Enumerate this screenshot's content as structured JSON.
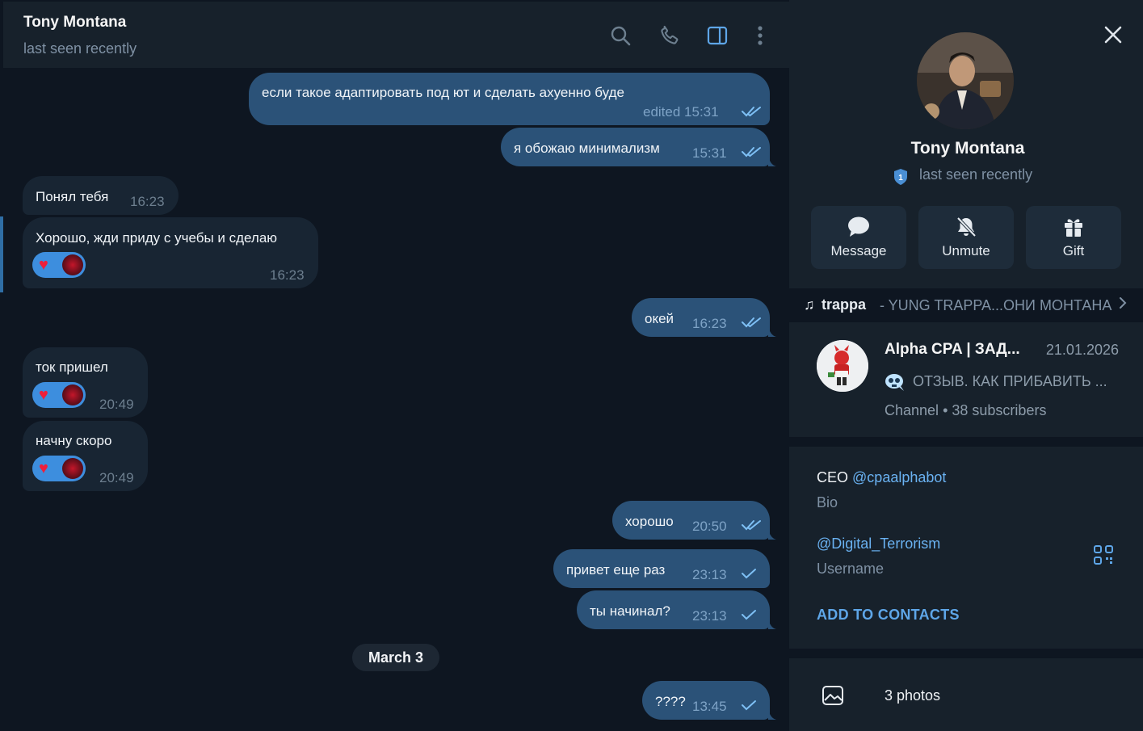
{
  "chat": {
    "title": "Tony Montana",
    "status": "last seen recently",
    "messages": [
      {
        "dir": "out",
        "text": "если такое адаптировать под ют и сделать ахуенно буде",
        "time": "edited 15:31",
        "read": true
      },
      {
        "dir": "out",
        "text": "я обожаю минимализм",
        "time": "15:31",
        "read": true
      },
      {
        "dir": "in",
        "text": "Понял тебя",
        "time": "16:23"
      },
      {
        "dir": "in",
        "text": "Хорошо, жди приду с учебы и сделаю",
        "time": "16:23",
        "reaction": "heart"
      },
      {
        "dir": "out",
        "text": "окей",
        "time": "16:23",
        "read": true
      },
      {
        "dir": "in",
        "text": "ток пришел",
        "time": "20:49",
        "reaction": "heart"
      },
      {
        "dir": "in",
        "text": "начну скоро",
        "time": "20:49",
        "reaction": "heart"
      },
      {
        "dir": "out",
        "text": "хорошо",
        "time": "20:50",
        "read": true
      },
      {
        "dir": "out",
        "text": "привет еще раз",
        "time": "23:13",
        "read": false
      },
      {
        "dir": "out",
        "text": "ты начинал?",
        "time": "23:13",
        "read": false
      },
      {
        "dir": "out",
        "text": "????",
        "time": "13:45",
        "read": false
      }
    ],
    "date_separator": "March 3"
  },
  "header_icons": [
    "search-icon",
    "phone-icon",
    "sidebar-toggle-icon",
    "more-vertical-icon"
  ],
  "profile": {
    "name": "Tony Montana",
    "status": "last seen recently",
    "actions": [
      {
        "label": "Message",
        "icon": "message-icon"
      },
      {
        "label": "Unmute",
        "icon": "bell-off-icon"
      },
      {
        "label": "Gift",
        "icon": "gift-icon"
      }
    ],
    "music": {
      "note": "♫",
      "track": "trappa",
      "artist": "- YUNG TRAPPA...ОНИ МОНТАНА"
    },
    "channel": {
      "title": "Alpha CPA | ЗАД...",
      "date": "21.01.2026",
      "preview": "ОТЗЫВ. КАК ПРИБАВИТЬ ...",
      "type": "Channel",
      "subscribers": "38 subscribers"
    },
    "bio": {
      "prefix": "CEO",
      "link": "@cpaalphabot",
      "label": "Bio"
    },
    "username": {
      "value": "@Digital_Terrorism",
      "label": "Username"
    },
    "add_contacts": "ADD TO CONTACTS",
    "media": {
      "label": "3 photos"
    }
  },
  "colors": {
    "bg": "#0e1621",
    "panel": "#17212b",
    "bubble_out": "#2b5278",
    "bubble_in": "#182533",
    "accent": "#6ab2f2"
  }
}
